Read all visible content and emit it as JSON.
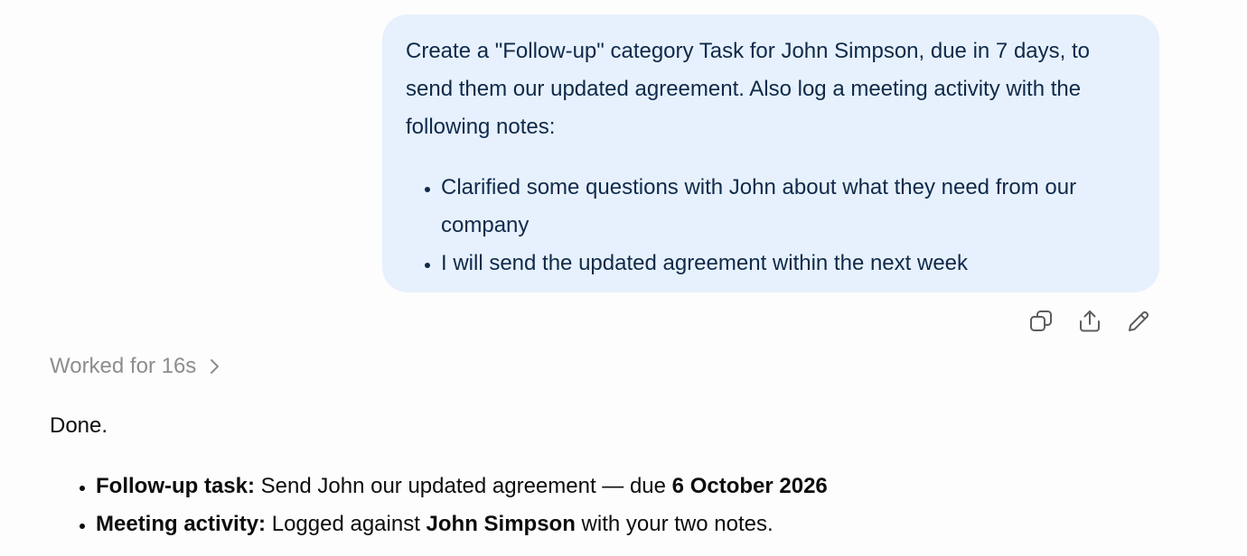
{
  "user_message": {
    "text": "Create a \"Follow-up\" category Task for John Simpson, due in 7 days, to send them our updated agreement. Also log a meeting activity with the following notes:",
    "bullets": [
      "Clarified some questions with John about what they need from our company",
      "I will send the updated agreement within the next week"
    ]
  },
  "message_actions": {
    "icons": [
      "copy-icon",
      "share-icon",
      "edit-icon"
    ]
  },
  "worked": {
    "label": "Worked for 16s"
  },
  "assistant": {
    "intro": "Done.",
    "items": [
      {
        "label": "Follow-up task:",
        "text": " Send John our updated agreement — due ",
        "emph": "6 October 2026",
        "tail": ""
      },
      {
        "label": "Meeting activity:",
        "text": " Logged against ",
        "emph": "John Simpson",
        "tail": " with your two notes."
      }
    ]
  },
  "colors": {
    "bubble_bg": "#e7f1fd",
    "bubble_text": "#0f2a4a",
    "muted": "#8d8d8d"
  }
}
